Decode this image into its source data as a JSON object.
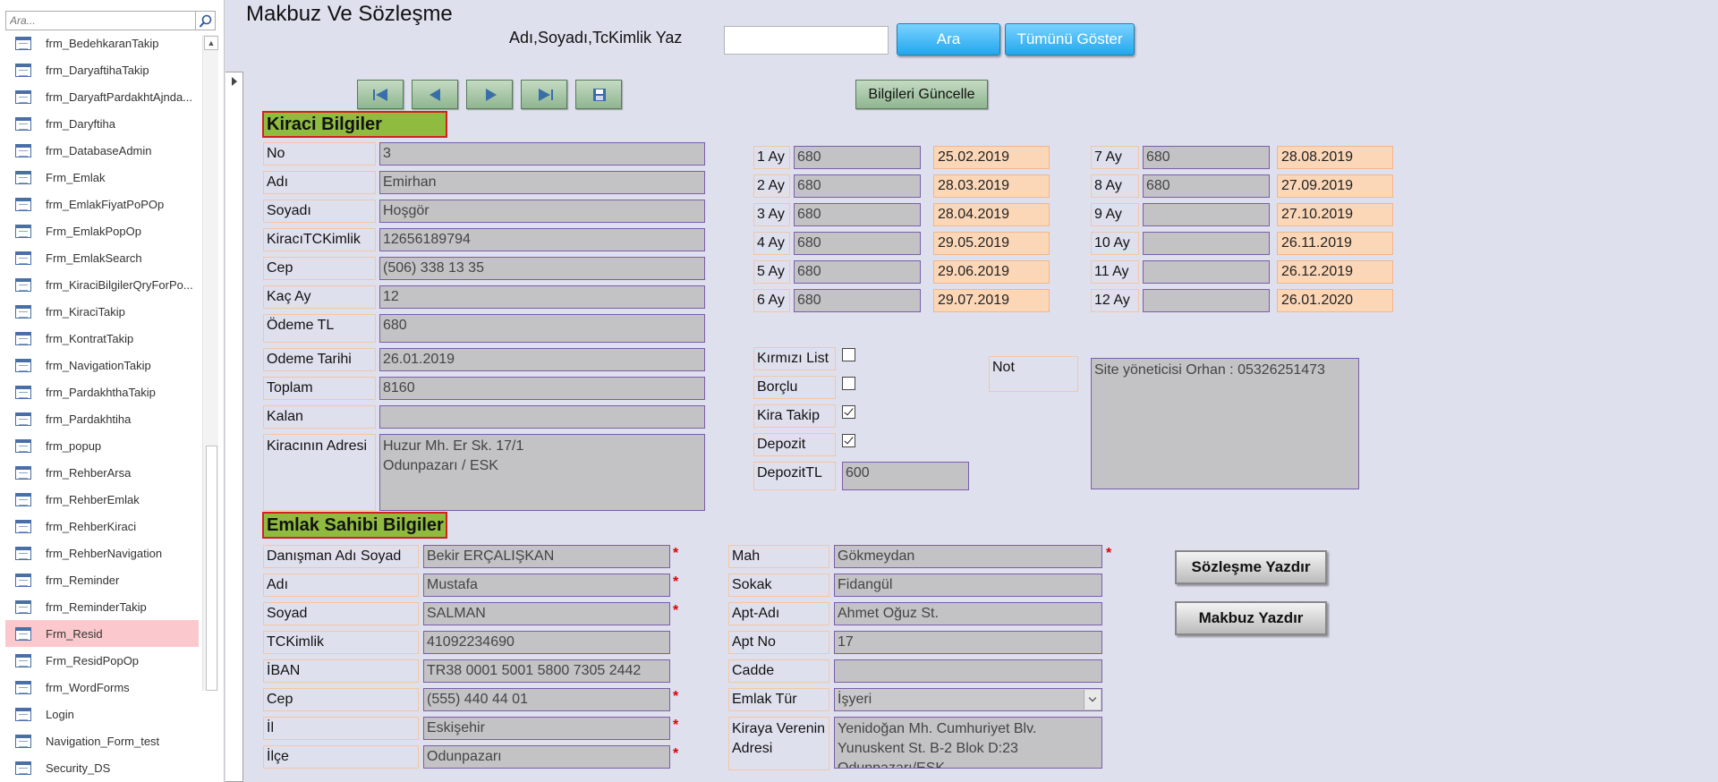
{
  "nav": {
    "search_placeholder": "Ara...",
    "items": [
      "frm_BedehkaranTakip",
      "frm_DaryaftihaTakip",
      "frm_DaryaftPardakhtAjnda...",
      "frm_Daryftiha",
      "frm_DatabaseAdmin",
      "Frm_Emlak",
      "frm_EmlakFiyatPoPOp",
      "Frm_EmlakPopOp",
      "Frm_EmlakSearch",
      "frm_KiraciBilgilerQryForPo...",
      "frm_KiraciTakip",
      "frm_KontratTakip",
      "frm_NavigationTakip",
      "frm_PardakhthaTakip",
      "frm_Pardakhtiha",
      "frm_popup",
      "frm_RehberArsa",
      "frm_RehberEmlak",
      "frm_RehberKiraci",
      "frm_RehberNavigation",
      "frm_Reminder",
      "frm_ReminderTakip",
      "Frm_Resid",
      "Frm_ResidPopOp",
      "frm_WordForms",
      "Login",
      "Navigation_Form_test",
      "Security_DS"
    ],
    "selected_index": 22
  },
  "form": {
    "title": "Makbuz Ve Sözleşme",
    "search_label": "Adı,Soyadı,TcKimlik Yaz",
    "search_value": "",
    "ara_label": "Ara",
    "show_all_label": "Tümünü Göster",
    "update_label": "Bilgileri Güncelle",
    "tenant_header": "Kiraci  Bilgiler",
    "tenant": {
      "no_label": "No",
      "no": "3",
      "adi_label": "Adı",
      "adi": "Emirhan",
      "soyadi_label": "Soyadı",
      "soyadi": "Hoşgör",
      "tc_label": "KiracıTCKimlik",
      "tc": "12656189794",
      "cep_label": "Cep",
      "cep": "(506) 338 13 35",
      "kac_ay_label": "Kaç Ay",
      "kac_ay": "12",
      "odeme_tl_label": "Ödeme TL",
      "odeme_tl": "680",
      "odeme_tarihi_label": "Odeme Tarihi",
      "odeme_tarihi": "26.01.2019",
      "toplam_label": "Toplam",
      "toplam": "8160",
      "kalan_label": "Kalan",
      "kalan": "",
      "adres_label": "Kiracının Adresi",
      "adres_line1": "Huzur Mh. Er Sk. 17/1",
      "adres_line2": "Odunpazarı / ESK"
    },
    "months_left": [
      {
        "label": "1 Ay",
        "amount": "680",
        "date": "25.02.2019"
      },
      {
        "label": "2 Ay",
        "amount": "680",
        "date": "28.03.2019"
      },
      {
        "label": "3 Ay",
        "amount": "680",
        "date": "28.04.2019"
      },
      {
        "label": "4 Ay",
        "amount": "680",
        "date": "29.05.2019"
      },
      {
        "label": "5 Ay",
        "amount": "680",
        "date": "29.06.2019"
      },
      {
        "label": "6 Ay",
        "amount": "680",
        "date": "29.07.2019"
      }
    ],
    "months_right": [
      {
        "label": "7 Ay",
        "amount": "680",
        "date": "28.08.2019"
      },
      {
        "label": "8 Ay",
        "amount": "680",
        "date": "27.09.2019"
      },
      {
        "label": "9 Ay",
        "amount": "",
        "date": "27.10.2019"
      },
      {
        "label": "10 Ay",
        "amount": "",
        "date": "26.11.2019"
      },
      {
        "label": "11 Ay",
        "amount": "",
        "date": "26.12.2019"
      },
      {
        "label": "12 Ay",
        "amount": "",
        "date": "26.01.2020"
      }
    ],
    "flags": {
      "kirmizi_list_label": "Kırmızı List",
      "kirmizi_list": false,
      "borclu_label": "Borçlu",
      "borclu": false,
      "kira_takip_label": "Kira Takip",
      "kira_takip": true,
      "depozit_label": "Depozit",
      "depozit": true,
      "depozit_tl_label": "DepozitTL",
      "depozit_tl": "600"
    },
    "not_label": "Not",
    "not_value": "Site yöneticisi Orhan : 05326251473",
    "owner_header": "Emlak Sahibi Bilgiler",
    "owner": {
      "danisman_label": "Danışman Adı Soyad",
      "danisman": "Bekir ERÇALIŞKAN",
      "adi_label": "Adı",
      "adi": "Mustafa",
      "soyad_label": "Soyad",
      "soyad": "SALMAN",
      "tc_label": "TCKimlik",
      "tc": "41092234690",
      "iban_label": "İBAN",
      "iban": "TR38 0001 5001 5800 7305 2442",
      "cep_label": "Cep",
      "cep": "(555) 440 44 01",
      "il_label": "İl",
      "il": "Eskişehir",
      "ilce_label": "İlçe",
      "ilce": "Odunpazarı"
    },
    "property": {
      "mah_label": "Mah",
      "mah": "Gökmeydan",
      "sokak_label": "Sokak",
      "sokak": "Fidangül",
      "apt_adi_label": "Apt-Adı",
      "apt_adi": "Ahmet Oğuz St.",
      "apt_no_label": "Apt No",
      "apt_no": "17",
      "cadde_label": "Cadde",
      "cadde": "",
      "emlak_tur_label": "Emlak Tür",
      "emlak_tur": "İşyeri",
      "kiraya_label": "Kiraya Verenin Adresi",
      "adres_line1": "Yenidoğan Mh. Cumhuriyet Blv.",
      "adres_line2": "Yunuskent St. B-2 Blok D:23",
      "adres_line3": "Odunpazarı/ESK"
    },
    "required_mark": "*",
    "sozlesme_btn": "Sözleşme Yazdır",
    "makbuz_btn": "Makbuz Yazdır"
  }
}
